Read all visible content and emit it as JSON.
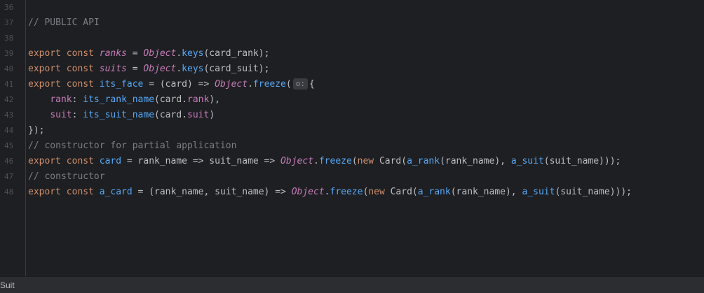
{
  "editor": {
    "lines": [
      {
        "n": "36",
        "tokens": []
      },
      {
        "n": "37",
        "tokens": [
          {
            "t": "// PUBLIC API",
            "c": "cm"
          }
        ]
      },
      {
        "n": "38",
        "tokens": []
      },
      {
        "n": "39",
        "tokens": [
          {
            "t": "export const ",
            "c": "kw"
          },
          {
            "t": "ranks",
            "c": "var-it"
          },
          {
            "t": " = ",
            "c": "plain"
          },
          {
            "t": "Object",
            "c": "obj"
          },
          {
            "t": ".",
            "c": "plain"
          },
          {
            "t": "keys",
            "c": "fn"
          },
          {
            "t": "(card_rank);",
            "c": "plain"
          }
        ]
      },
      {
        "n": "40",
        "tokens": [
          {
            "t": "export const ",
            "c": "kw"
          },
          {
            "t": "suits",
            "c": "var-it"
          },
          {
            "t": " = ",
            "c": "plain"
          },
          {
            "t": "Object",
            "c": "obj"
          },
          {
            "t": ".",
            "c": "plain"
          },
          {
            "t": "keys",
            "c": "fn"
          },
          {
            "t": "(card_suit);",
            "c": "plain"
          }
        ]
      },
      {
        "n": "41",
        "tokens": [
          {
            "t": "export const ",
            "c": "kw"
          },
          {
            "t": "its_face",
            "c": "var"
          },
          {
            "t": " = (card) => ",
            "c": "plain"
          },
          {
            "t": "Object",
            "c": "obj"
          },
          {
            "t": ".",
            "c": "plain"
          },
          {
            "t": "freeze",
            "c": "fn"
          },
          {
            "t": "(",
            "c": "plain"
          },
          {
            "t": "o:",
            "c": "hint"
          },
          {
            "t": "{",
            "c": "plain"
          }
        ]
      },
      {
        "n": "42",
        "tokens": [
          {
            "t": "    ",
            "c": "plain"
          },
          {
            "t": "rank",
            "c": "prop"
          },
          {
            "t": ": ",
            "c": "plain"
          },
          {
            "t": "its_rank_name",
            "c": "fn"
          },
          {
            "t": "(card.",
            "c": "plain"
          },
          {
            "t": "rank",
            "c": "prop"
          },
          {
            "t": "),",
            "c": "plain"
          }
        ]
      },
      {
        "n": "43",
        "tokens": [
          {
            "t": "    ",
            "c": "plain"
          },
          {
            "t": "suit",
            "c": "prop"
          },
          {
            "t": ": ",
            "c": "plain"
          },
          {
            "t": "its_suit_name",
            "c": "fn"
          },
          {
            "t": "(card.",
            "c": "plain"
          },
          {
            "t": "suit",
            "c": "prop"
          },
          {
            "t": ")",
            "c": "plain"
          }
        ]
      },
      {
        "n": "44",
        "tokens": [
          {
            "t": "});",
            "c": "plain"
          }
        ]
      },
      {
        "n": "45",
        "tokens": [
          {
            "t": "// constructor for partial application",
            "c": "cm"
          }
        ]
      },
      {
        "n": "46",
        "tokens": [
          {
            "t": "export const ",
            "c": "kw"
          },
          {
            "t": "card",
            "c": "var"
          },
          {
            "t": " = rank_name => suit_name => ",
            "c": "plain"
          },
          {
            "t": "Object",
            "c": "obj"
          },
          {
            "t": ".",
            "c": "plain"
          },
          {
            "t": "freeze",
            "c": "fn"
          },
          {
            "t": "(",
            "c": "plain"
          },
          {
            "t": "new ",
            "c": "kw"
          },
          {
            "t": "Card(",
            "c": "plain"
          },
          {
            "t": "a_rank",
            "c": "fn"
          },
          {
            "t": "(rank_name), ",
            "c": "plain"
          },
          {
            "t": "a_suit",
            "c": "fn"
          },
          {
            "t": "(suit_name)));",
            "c": "plain"
          }
        ]
      },
      {
        "n": "47",
        "tokens": [
          {
            "t": "// constructor",
            "c": "cm"
          }
        ]
      },
      {
        "n": "48",
        "tokens": [
          {
            "t": "export const ",
            "c": "kw"
          },
          {
            "t": "a_card",
            "c": "var"
          },
          {
            "t": " = (rank_name, suit_name) => ",
            "c": "plain"
          },
          {
            "t": "Object",
            "c": "obj"
          },
          {
            "t": ".",
            "c": "plain"
          },
          {
            "t": "freeze",
            "c": "fn"
          },
          {
            "t": "(",
            "c": "plain"
          },
          {
            "t": "new ",
            "c": "kw"
          },
          {
            "t": "Card(",
            "c": "plain"
          },
          {
            "t": "a_rank",
            "c": "fn"
          },
          {
            "t": "(rank_name), ",
            "c": "plain"
          },
          {
            "t": "a_suit",
            "c": "fn"
          },
          {
            "t": "(suit_name)));",
            "c": "plain"
          }
        ]
      }
    ]
  },
  "statusbar": {
    "breadcrumb": "Suit"
  },
  "colors": {
    "background": "#1e1f22",
    "keyword": "#cf8e6d",
    "function": "#56a8f5",
    "property": "#c77dbb",
    "comment": "#7a7e85",
    "text": "#bcbec4",
    "line_number": "#4b5059"
  }
}
